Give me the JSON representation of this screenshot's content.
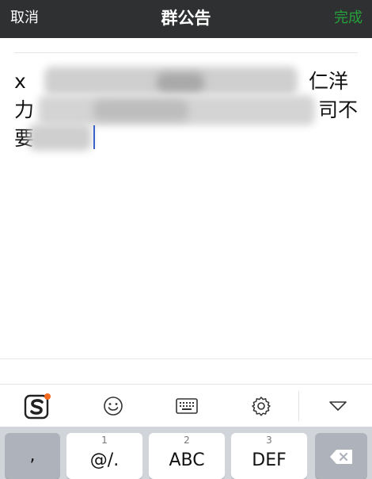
{
  "navbar": {
    "cancel_label": "取消",
    "title": "群公告",
    "done_label": "完成",
    "done_color": "#24a33a"
  },
  "editor": {
    "line1_start": "x",
    "line1_end": "仁洋",
    "line2_start": "力",
    "line2_end": "司不",
    "line3_start": "要"
  },
  "toolbar": {
    "items": [
      {
        "icon": "sogou-logo-icon"
      },
      {
        "icon": "emoji-icon"
      },
      {
        "icon": "keyboard-icon"
      },
      {
        "icon": "settings-icon"
      },
      {
        "icon": "collapse-keyboard-icon"
      }
    ]
  },
  "keyboard": {
    "keys": [
      {
        "label": ",",
        "num": ""
      },
      {
        "label": "@/.",
        "num": "1"
      },
      {
        "label": "ABC",
        "num": "2"
      },
      {
        "label": "DEF",
        "num": "3"
      }
    ],
    "delete_icon": "backspace-icon"
  }
}
